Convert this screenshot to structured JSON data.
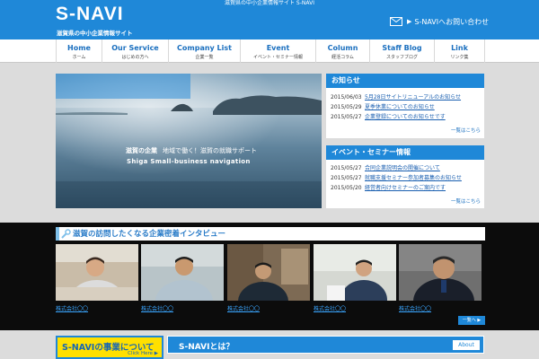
{
  "header": {
    "top_tagline": "滋賀県の中小企業情報サイト S-NAVI",
    "logo": "S-NAVI",
    "logo_sub": "滋賀県の中小企業情報サイト",
    "contact_label": "S-NAVIへお問い合わせ",
    "contact_arrow": "▶",
    "bg_color": "#1f88d8"
  },
  "nav": [
    {
      "main": "Home",
      "sub": "ホーム"
    },
    {
      "main": "Our Service",
      "sub": "はじめの方へ"
    },
    {
      "main": "Company List",
      "sub": "企業一覧"
    },
    {
      "main": "Event",
      "sub": "イベント・セミナー情報"
    },
    {
      "main": "Column",
      "sub": "経活コラム"
    },
    {
      "main": "Staff Blog",
      "sub": "スタッフブログ"
    },
    {
      "main": "Link",
      "sub": "リンク集"
    }
  ],
  "hero": {
    "line1_bold": "滋賀の企業",
    "line1_rest": "地域で働く！滋賀の就職サポート",
    "line2": "Shiga   Small-business   navigation"
  },
  "news": {
    "title": "お知らせ",
    "items": [
      {
        "date": "2015/06/03",
        "text": "5月28日サイトリニューアルのお知らせ"
      },
      {
        "date": "2015/05/29",
        "text": "夏季休業についてのお知らせ"
      },
      {
        "date": "2015/05/27",
        "text": "企業登録についてのお知らせです"
      }
    ],
    "more": "一覧はこちら"
  },
  "events": {
    "title": "イベント・セミナー情報",
    "items": [
      {
        "date": "2015/05/27",
        "text": "合同企業説明会の開催について"
      },
      {
        "date": "2015/05/27",
        "text": "就職支援セミナー参加者募集のお知らせ"
      },
      {
        "date": "2015/05/20",
        "text": "経営者向けセミナーのご案内です"
      }
    ],
    "more": "一覧はこちら"
  },
  "interviews": {
    "title": "滋賀の訪問したくなる企業密着インタビュー",
    "items": [
      {
        "label": "株式会社〇〇"
      },
      {
        "label": "株式会社〇〇"
      },
      {
        "label": "株式会社〇〇"
      },
      {
        "label": "株式会社〇〇"
      },
      {
        "label": "株式会社〇〇"
      }
    ],
    "more": "一覧へ ▶"
  },
  "bottom": {
    "business_title": "S-NAVIの事業について",
    "business_sub": "Click Here ▶",
    "about_title": "S-NAVIとは？",
    "about_button": "About"
  }
}
